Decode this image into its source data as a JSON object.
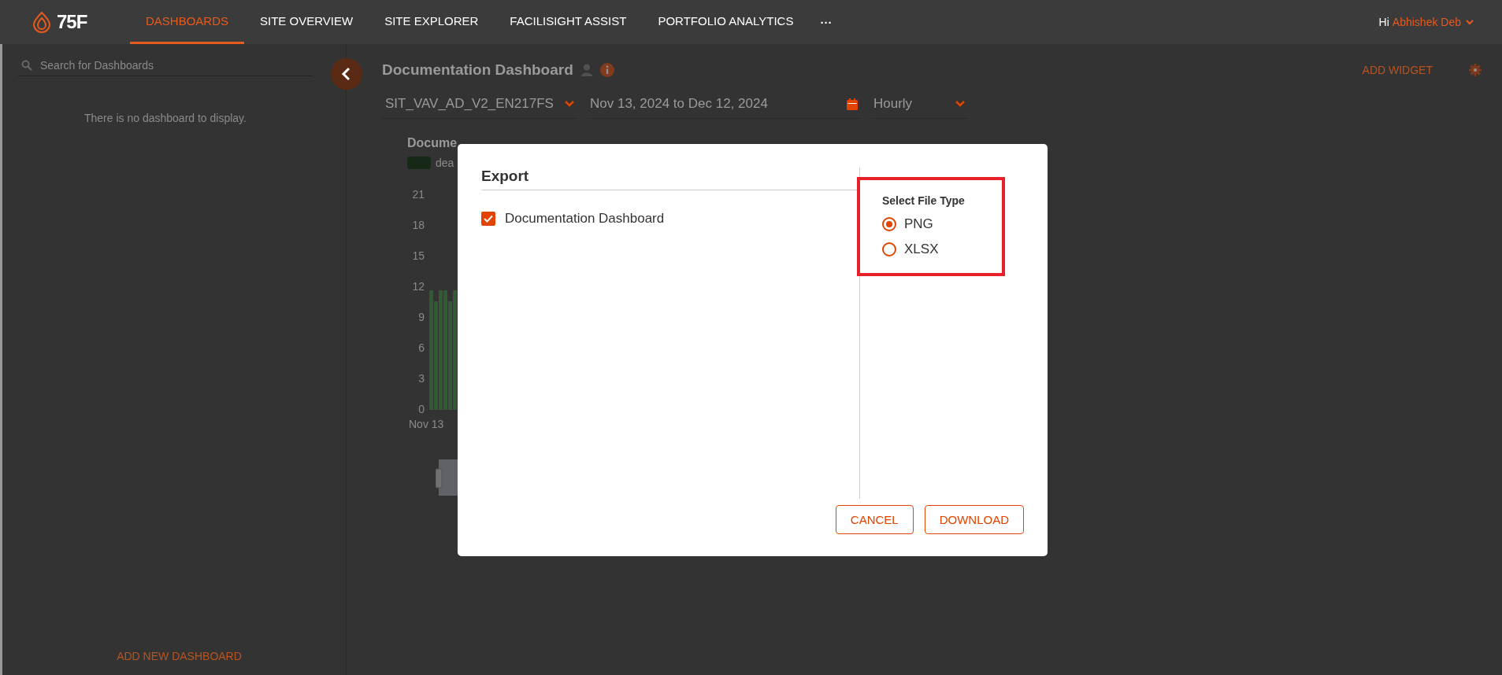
{
  "header": {
    "logo_text": "75F",
    "nav": [
      {
        "label": "DASHBOARDS",
        "selected": true
      },
      {
        "label": "SITE OVERVIEW",
        "selected": false
      },
      {
        "label": "SITE EXPLORER",
        "selected": false
      },
      {
        "label": "FACILISIGHT ASSIST",
        "selected": false
      },
      {
        "label": "PORTFOLIO ANALYTICS",
        "selected": false
      }
    ],
    "more": "···",
    "greeting": "Hi",
    "user": "Abhishek Deb"
  },
  "sidebar": {
    "search": {
      "placeholder": "Search for Dashboards"
    },
    "empty_message": "There is no dashboard to display.",
    "add_button": "ADD NEW DASHBOARD"
  },
  "dashboard": {
    "title": "Documentation Dashboard",
    "add_widget": "ADD WIDGET",
    "filters": {
      "equipment": "SIT_VAV_AD_V2_EN217FS",
      "date_range": "Nov 13, 2024 to Dec 12, 2024",
      "interval": "Hourly"
    },
    "widget": {
      "title": "Docume",
      "legend": "dea",
      "y_ticks": [
        "21",
        "18",
        "15",
        "12",
        "9",
        "6",
        "3",
        "0"
      ],
      "x_label": "Nov 13"
    }
  },
  "export_dialog": {
    "title": "Export",
    "items": [
      {
        "label": "Documentation Dashboard",
        "checked": true
      }
    ],
    "file_type": {
      "title": "Select File Type",
      "highlighted": true,
      "options": [
        {
          "label": "PNG",
          "selected": true
        },
        {
          "label": "XLSX",
          "selected": false
        }
      ]
    },
    "buttons": [
      "CANCEL",
      "DOWNLOAD"
    ]
  }
}
